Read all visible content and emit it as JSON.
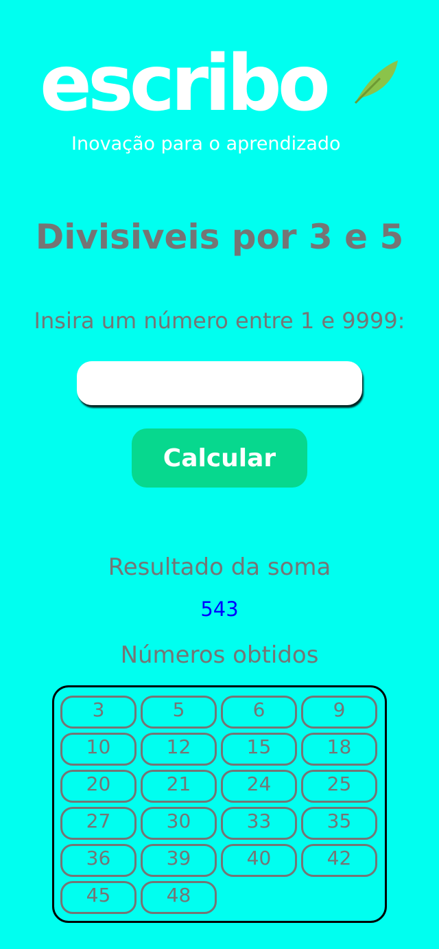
{
  "logo": {
    "name": "escribo",
    "tagline": "Inovação para o aprendizado"
  },
  "title": "Divisiveis por 3 e 5",
  "prompt": "Insira um número entre 1 e 9999:",
  "input": {
    "value": "",
    "placeholder": ""
  },
  "button": {
    "label": "Calcular"
  },
  "result": {
    "label": "Resultado da soma",
    "value": "543"
  },
  "numbers": {
    "label": "Números obtidos",
    "items": [
      "3",
      "5",
      "6",
      "9",
      "10",
      "12",
      "15",
      "18",
      "20",
      "21",
      "24",
      "25",
      "27",
      "30",
      "33",
      "35",
      "36",
      "39",
      "40",
      "42",
      "45",
      "48"
    ]
  },
  "colors": {
    "background": "#00FFF0",
    "button": "#07D88E",
    "text": "#757575",
    "result": "#0000FF"
  }
}
